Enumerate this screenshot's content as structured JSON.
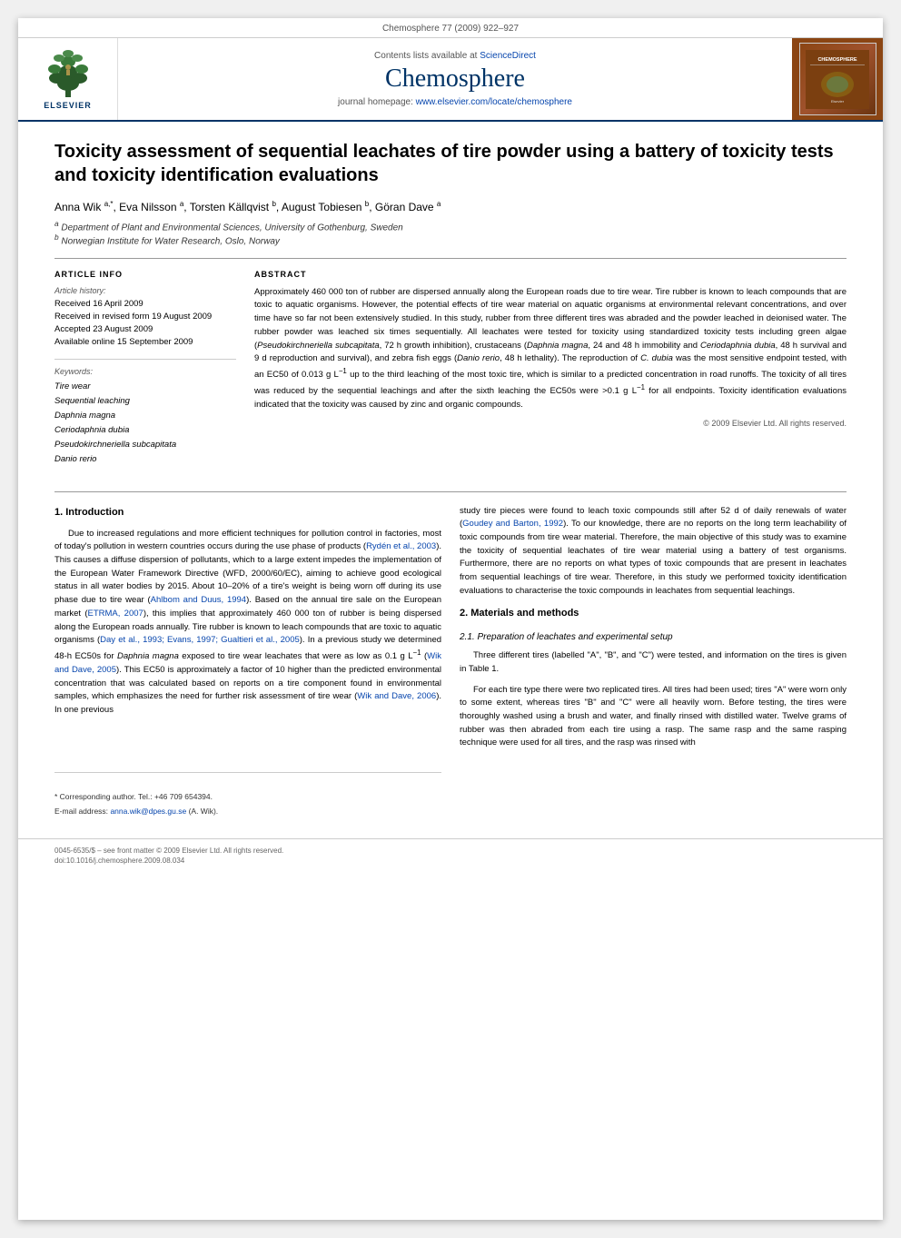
{
  "citation": {
    "text": "Chemosphere 77 (2009) 922–927"
  },
  "journal": {
    "sciencedirect_text": "Contents lists available at",
    "sciencedirect_link": "ScienceDirect",
    "name": "Chemosphere",
    "homepage_label": "journal homepage:",
    "homepage_url": "www.elsevier.com/locate/chemosphere"
  },
  "elsevier": {
    "brand": "ELSEVIER"
  },
  "article": {
    "title": "Toxicity assessment of sequential leachates of tire powder using a battery of toxicity tests and toxicity identification evaluations",
    "authors": "Anna Wik a,*, Eva Nilsson a, Torsten Källqvist b, August Tobiesen b, Göran Dave a",
    "affiliations": [
      "a Department of Plant and Environmental Sciences, University of Gothenburg, Sweden",
      "b Norwegian Institute for Water Research, Oslo, Norway"
    ],
    "article_info": {
      "label": "Article Info",
      "history_label": "Article history:",
      "received": "Received 16 April 2009",
      "revised": "Received in revised form 19 August 2009",
      "accepted": "Accepted 23 August 2009",
      "available": "Available online 15 September 2009"
    },
    "keywords": {
      "label": "Keywords:",
      "items": [
        "Tire wear",
        "Sequential leaching",
        "Daphnia magna",
        "Ceriodaphnia dubia",
        "Pseudokirchneriella subcapitata",
        "Danio rerio"
      ]
    },
    "abstract": {
      "label": "Abstract",
      "text": "Approximately 460 000 ton of rubber are dispersed annually along the European roads due to tire wear. Tire rubber is known to leach compounds that are toxic to aquatic organisms. However, the potential effects of tire wear material on aquatic organisms at environmental relevant concentrations, and over time have so far not been extensively studied. In this study, rubber from three different tires was abraded and the powder leached in deionised water. The rubber powder was leached six times sequentially. All leachates were tested for toxicity using standardized toxicity tests including green algae (Pseudokirchneriella subcapitata, 72 h growth inhibition), crustaceans (Daphnia magna, 24 and 48 h immobility and Ceriodaphnia dubia, 48 h survival and 9 d reproduction and survival), and zebra fish eggs (Danio rerio, 48 h lethality). The reproduction of C. dubia was the most sensitive endpoint tested, with an EC50 of 0.013 g L⁻¹ up to the third leaching of the most toxic tire, which is similar to a predicted concentration in road runoffs. The toxicity of all tires was reduced by the sequential leachings and after the sixth leaching the EC50s were >0.1 g L⁻¹ for all endpoints. Toxicity identification evaluations indicated that the toxicity was caused by zinc and organic compounds."
    },
    "copyright": "© 2009 Elsevier Ltd. All rights reserved.",
    "sections": {
      "introduction": {
        "number": "1.",
        "title": "Introduction",
        "paragraphs": [
          "Due to increased regulations and more efficient techniques for pollution control in factories, most of today's pollution in western countries occurs during the use phase of products (Rydén et al., 2003). This causes a diffuse dispersion of pollutants, which to a large extent impedes the implementation of the European Water Framework Directive (WFD, 2000/60/EC), aiming to achieve good ecological status in all water bodies by 2015. About 10–20% of a tire's weight is being worn off during its use phase due to tire wear (Ahlbom and Duus, 1994). Based on the annual tire sale on the European market (ETRMA, 2007), this implies that approximately 460 000 ton of rubber is being dispersed along the European roads annually. Tire rubber is known to leach compounds that are toxic to aquatic organisms (Day et al., 1993; Evans, 1997; Gualtieri et al., 2005). In a previous study we determined 48-h EC50s for Daphnia magna exposed to tire wear leachates that were as low as 0.1 g L⁻¹ (Wik and Dave, 2005). This EC50 is approximately a factor of 10 higher than the predicted environmental concentration that was calculated based on reports on a tire component found in environmental samples, which emphasizes the need for further risk assessment of tire wear (Wik and Dave, 2006). In one previous",
          "study tire pieces were found to leach toxic compounds still after 52 d of daily renewals of water (Goudey and Barton, 1992). To our knowledge, there are no reports on the long term leachability of toxic compounds from tire wear material. Therefore, the main objective of this study was to examine the toxicity of sequential leachates of tire wear material using a battery of test organisms. Furthermore, there are no reports on what types of toxic compounds that are present in leachates from sequential leachings of tire wear. Therefore, in this study we performed toxicity identification evaluations to characterise the toxic compounds in leachates from sequential leachings."
        ]
      },
      "materials": {
        "number": "2.",
        "title": "Materials and methods",
        "subsection": {
          "number": "2.1.",
          "title": "Preparation of leachates and experimental setup",
          "paragraphs": [
            "Three different tires (labelled \"A\", \"B\", and \"C\") were tested, and information on the tires is given in Table 1.",
            "For each tire type there were two replicated tires. All tires had been used; tires \"A\" were worn only to some extent, whereas tires \"B\" and \"C\" were all heavily worn. Before testing, the tires were thoroughly washed using a brush and water, and finally rinsed with distilled water. Twelve grams of rubber was then abraded from each tire using a rasp. The same rasp and the same rasping technique were used for all tires, and the rasp was rinsed with"
          ]
        }
      }
    },
    "footnotes": {
      "corresponding": "* Corresponding author. Tel.: +46 709 654394.",
      "email_label": "E-mail address:",
      "email": "anna.wik@dpes.gu.se",
      "email_suffix": "(A. Wik)."
    },
    "footer": {
      "issn": "0045-6535/$ – see front matter © 2009 Elsevier Ltd. All rights reserved.",
      "doi": "doi:10.1016/j.chemosphere.2009.08.034"
    },
    "table_ref": "Table"
  }
}
